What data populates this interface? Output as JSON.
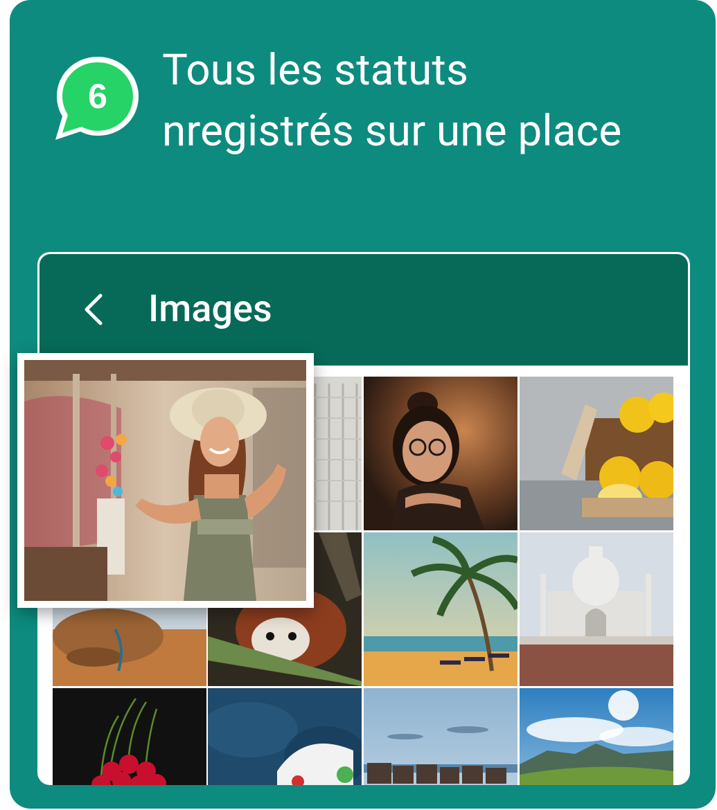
{
  "promo": {
    "step_number": "6",
    "headline_line1": "Tous les statuts",
    "headline_line2": "nregistrés sur une place",
    "brand_color": "#0d8b7e",
    "badge_color": "#25d366"
  },
  "screen": {
    "title": "Images",
    "back_icon": "chevron-left-icon",
    "appbar_color": "#076a58"
  },
  "gallery": {
    "featured": "woman-in-sun-hat-photo",
    "thumbnails": [
      "window-shutters-photo",
      "woman-with-glasses-photo",
      "lemons-on-table-photo",
      "camel-photo",
      "red-panda-photo",
      "palm-beach-photo",
      "taj-mahal-photo",
      "cherries-photo",
      "blue-texture-with-basket-photo",
      "seaside-houses-photo",
      "mountain-landscape-photo"
    ]
  }
}
